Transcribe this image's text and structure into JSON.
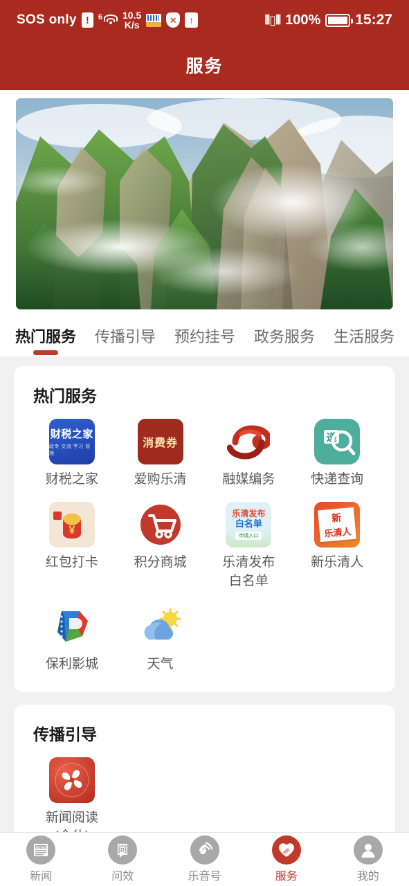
{
  "status_bar": {
    "carrier": "SOS only",
    "alert_icon": "!",
    "network_generation": "6",
    "network_icon": "wifi-icon",
    "speed": "10.5",
    "speed_unit": "K/s",
    "card_icon": "sim-card-icon",
    "shield_icon": "shield-block-icon",
    "upload_icon": "upload-arrow-icon",
    "vibrate_icon": "vibrate-icon",
    "battery_percent": "100%",
    "battery_icon": "battery-full-icon",
    "time": "15:27"
  },
  "header": {
    "title": "服务"
  },
  "banner": {
    "name": "scenic-mountain-banner",
    "alt": "云雾缭绕的雁荡山峰林风景图"
  },
  "tabs": [
    {
      "label": "热门服务",
      "active": true
    },
    {
      "label": "传播引导",
      "active": false
    },
    {
      "label": "预约挂号",
      "active": false
    },
    {
      "label": "政务服务",
      "active": false
    },
    {
      "label": "生活服务",
      "active": false
    }
  ],
  "sections": [
    {
      "title": "热门服务",
      "items": [
        {
          "label": "财税之家",
          "icon": "tax-home-icon",
          "icon_text": "财税之家",
          "icon_subtext": "政专 交流 学习 管理"
        },
        {
          "label": "爱购乐清",
          "icon": "consumer-voucher-icon",
          "icon_text": "消费券"
        },
        {
          "label": "融媒编务",
          "icon": "media-swirl-icon"
        },
        {
          "label": "快递查询",
          "icon": "express-search-icon",
          "icon_text": "递"
        },
        {
          "label": "红包打卡",
          "icon": "red-packet-icon",
          "icon_text": "¥"
        },
        {
          "label": "积分商城",
          "icon": "shopping-cart-icon"
        },
        {
          "label": "乐清发布\n白名单",
          "icon": "yueqing-whitelist-icon",
          "icon_text_1": "乐清发布",
          "icon_text_2": "白名单",
          "icon_text_3": "申请入口"
        },
        {
          "label": "新乐清人",
          "icon": "new-yueqing-people-icon",
          "icon_text_1": "新",
          "icon_text_2": "乐清人"
        },
        {
          "label": "保利影城",
          "icon": "poly-cinema-icon"
        },
        {
          "label": "天气",
          "icon": "weather-cloud-sun-icon"
        }
      ]
    },
    {
      "title": "传播引导",
      "items": [
        {
          "label": "新闻阅读\n(全休)",
          "icon": "news-reading-icon"
        }
      ]
    }
  ],
  "bottom_nav": [
    {
      "label": "新闻",
      "icon": "news-icon",
      "active": false
    },
    {
      "label": "问效",
      "icon": "feedback-icon",
      "active": false
    },
    {
      "label": "乐音号",
      "icon": "broadcast-icon",
      "active": false
    },
    {
      "label": "服务",
      "icon": "service-heart-icon",
      "active": true
    },
    {
      "label": "我的",
      "icon": "profile-icon",
      "active": false
    }
  ],
  "colors": {
    "brand_red": "#a92a1e",
    "accent_red": "#c0392b",
    "page_bg": "#f1f1f1",
    "card_bg": "#ffffff",
    "muted_text": "#5a5a5a"
  }
}
